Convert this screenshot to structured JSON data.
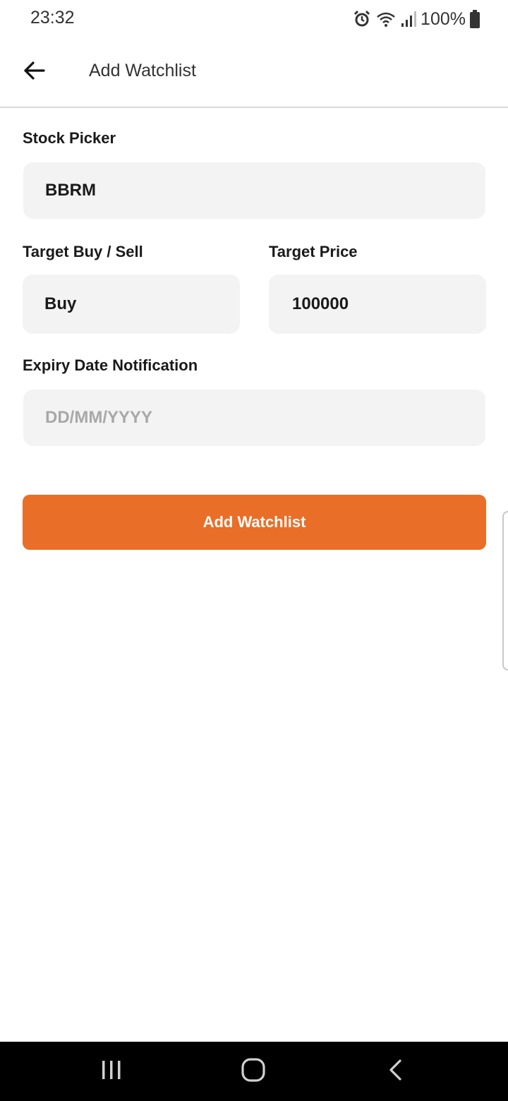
{
  "status_bar": {
    "time": "23:32",
    "battery": "100%",
    "icons": [
      "alarm-icon",
      "wifi-icon",
      "signal-icon",
      "battery-icon"
    ]
  },
  "app_bar": {
    "title": "Add Watchlist",
    "back_icon": "arrow-left-icon"
  },
  "form": {
    "stock_picker": {
      "label": "Stock Picker",
      "value": "BBRM"
    },
    "target_type": {
      "label": "Target Buy / Sell",
      "value": "Buy"
    },
    "target_price": {
      "label": "Target Price",
      "value": "100000"
    },
    "expiry_date": {
      "label": "Expiry Date Notification",
      "placeholder": "DD/MM/YYYY"
    },
    "submit_label": "Add Watchlist"
  },
  "nav_bar": {
    "icons": [
      "recents-icon",
      "home-icon",
      "back-icon"
    ]
  },
  "colors": {
    "accent": "#e96e27",
    "field_background": "#f3f3f3",
    "placeholder": "#a8a8a8"
  }
}
